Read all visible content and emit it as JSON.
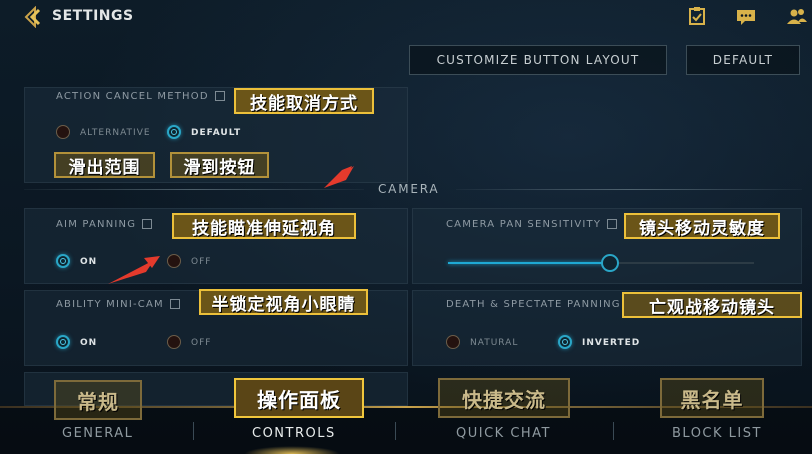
{
  "header": {
    "title": "SETTINGS"
  },
  "buttons": {
    "customize": "CUSTOMIZE BUTTON LAYOUT",
    "default": "DEFAULT"
  },
  "action_cancel": {
    "label": "ACTION CANCEL METHOD",
    "options": [
      "ALTERNATIVE",
      "DEFAULT"
    ],
    "selected": "DEFAULT",
    "anno": "技能取消方式",
    "anno_options": [
      "滑出范围",
      "滑到按钮"
    ]
  },
  "camera_section": {
    "title": "CAMERA"
  },
  "aim_panning": {
    "label": "AIM PANNING",
    "on": "ON",
    "off": "OFF",
    "selected": "ON",
    "anno": "技能瞄准伸延视角"
  },
  "camera_pan": {
    "label": "CAMERA PAN SENSITIVITY",
    "value": 0.53,
    "anno": "镜头移动灵敏度"
  },
  "ability_mini_cam": {
    "label": "ABILITY MINI-CAM",
    "on": "ON",
    "off": "OFF",
    "selected": "ON",
    "anno": "半锁定视角小眼睛"
  },
  "death_spectate": {
    "label": "DEATH & SPECTATE PANNING",
    "options": [
      "NATURAL",
      "INVERTED"
    ],
    "selected": "INVERTED",
    "anno": "亡观战移动镜头"
  },
  "tabs": [
    {
      "label": "GENERAL",
      "anno": "常规"
    },
    {
      "label": "CONTROLS",
      "anno": "操作面板"
    },
    {
      "label": "QUICK CHAT",
      "anno": "快捷交流"
    },
    {
      "label": "BLOCK LIST",
      "anno": "黑名单"
    }
  ],
  "active_tab": "CONTROLS",
  "colors": {
    "accent": "#1fa9d4",
    "gold": "#ecc03a",
    "bg": "#0b1722"
  },
  "icons": [
    "back-arrow-icon",
    "mission-icon",
    "chat-icon",
    "friends-icon",
    "chevron-down-icon"
  ]
}
